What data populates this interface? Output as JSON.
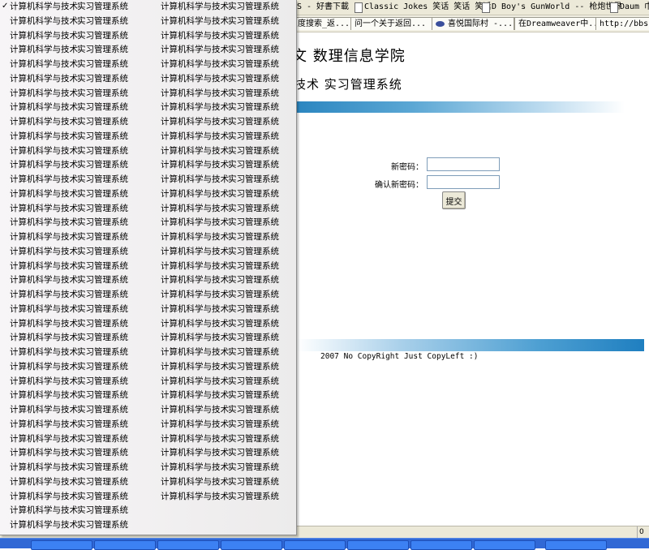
{
  "links_bar": [
    {
      "label": "S -",
      "icon": false
    },
    {
      "label": "好書下載",
      "icon": false
    },
    {
      "label": "Classic Jokes 笑话 笑话 笑话",
      "icon": true
    },
    {
      "label": "D Boy's GunWorld -- 枪炮世界",
      "icon": true
    },
    {
      "label": "Daum 巾",
      "icon": true
    }
  ],
  "tabs": [
    {
      "label": "度搜索_返..."
    },
    {
      "label": "问一个关于返回..."
    },
    {
      "label": "喜悦国际村 -..."
    },
    {
      "label": "在Dreamweaver中..."
    },
    {
      "label": "http://bbs.b"
    }
  ],
  "page": {
    "title_line1": "文 数理信息学院",
    "title_line2": "技术 实习管理系统",
    "new_password_label": "新密码：",
    "confirm_password_label": "确认新密码：",
    "new_password_value": "",
    "confirm_password_value": "",
    "submit_label": "提交",
    "copyright": "2007 No CopyRight Just CopyLeft :)"
  },
  "status": {
    "zone_text": "0"
  },
  "dropdown": {
    "check_mark": "✓",
    "part1": "计算机科学与技术",
    "part2": "实习管理系统",
    "column1_count": 37,
    "column2_count": 35
  },
  "colors": {
    "band_blue": "#2b86c0",
    "taskbar_blue": "#3168d5",
    "chrome_gray": "#ece9d8"
  }
}
